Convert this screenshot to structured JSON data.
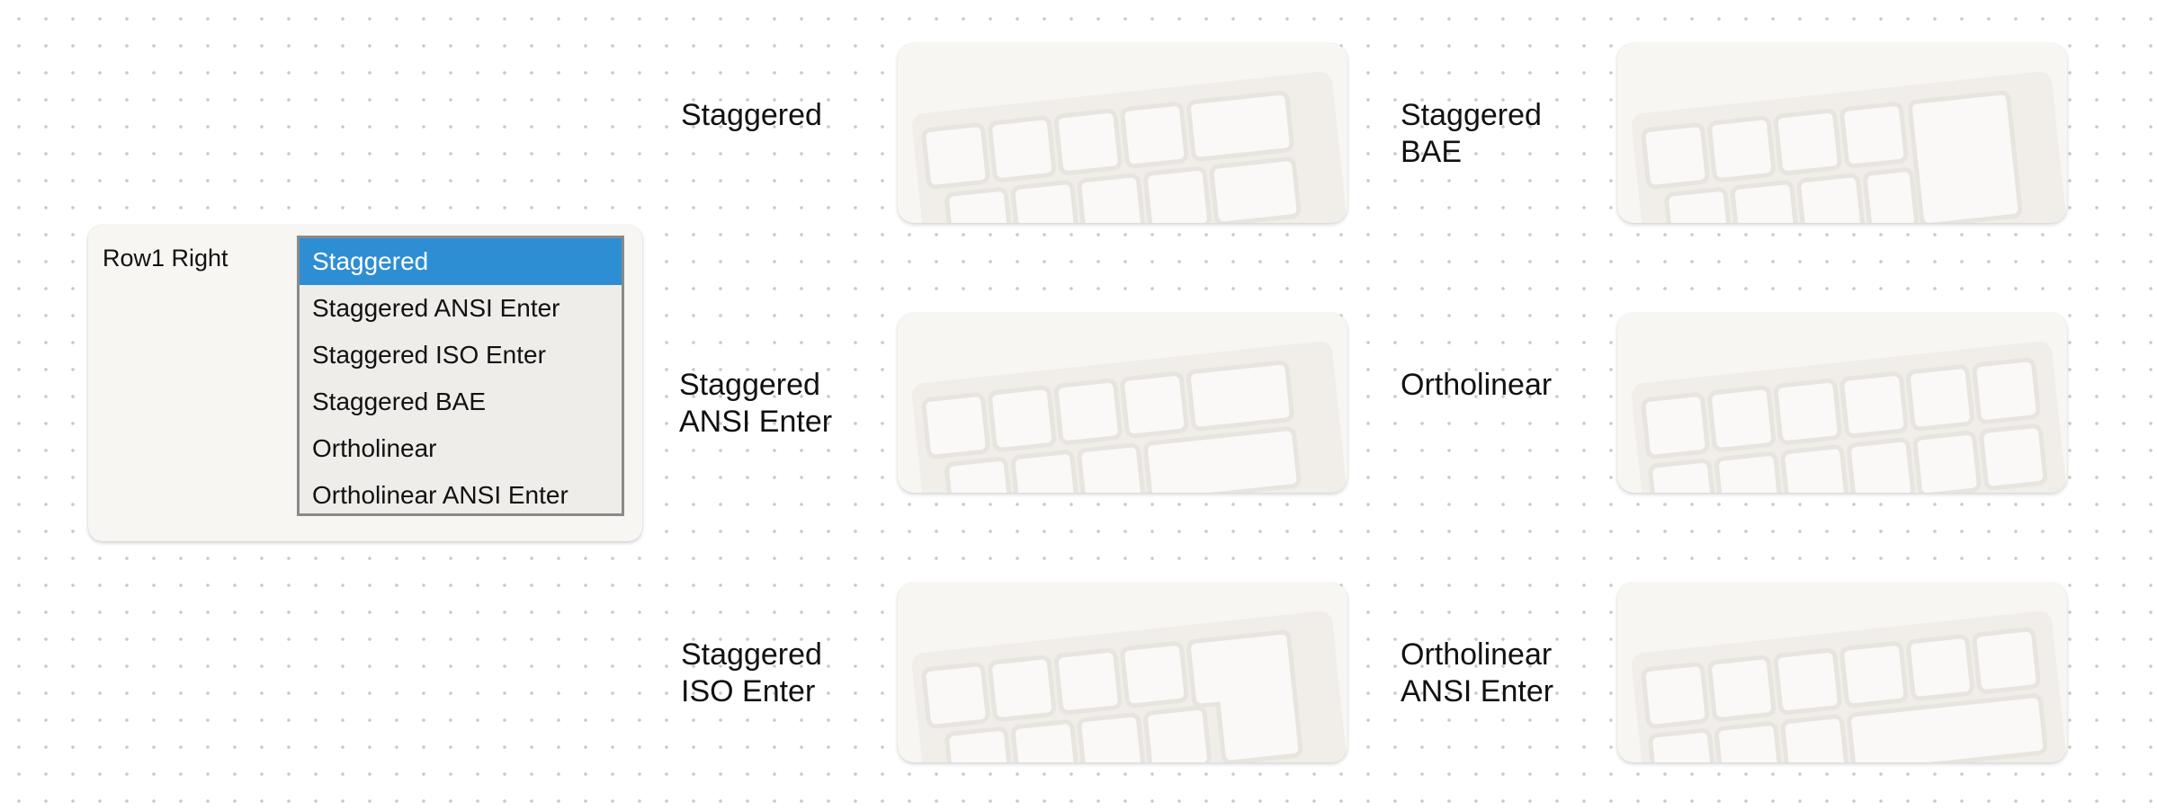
{
  "setting": {
    "label": "Row1 Right",
    "selected": "Staggered",
    "options": [
      "Staggered",
      "Staggered ANSI Enter",
      "Staggered ISO Enter",
      "Staggered BAE",
      "Ortholinear",
      "Ortholinear ANSI Enter"
    ]
  },
  "previews": [
    {
      "label_line1": "Staggered",
      "label_line2": "",
      "icon": "keyboard-staggered-icon"
    },
    {
      "label_line1": "Staggered",
      "label_line2": "BAE",
      "icon": "keyboard-staggered-bae-icon"
    },
    {
      "label_line1": "Staggered",
      "label_line2": "ANSI Enter",
      "icon": "keyboard-staggered-ansi-enter-icon"
    },
    {
      "label_line1": "Ortholinear",
      "label_line2": "",
      "icon": "keyboard-ortholinear-icon"
    },
    {
      "label_line1": "Staggered",
      "label_line2": "ISO Enter",
      "icon": "keyboard-staggered-iso-enter-icon"
    },
    {
      "label_line1": "Ortholinear",
      "label_line2": "ANSI Enter",
      "icon": "keyboard-ortholinear-ansi-enter-icon"
    }
  ],
  "colors": {
    "selection": "#2e8ed4",
    "card_background": "#f8f6f3"
  }
}
